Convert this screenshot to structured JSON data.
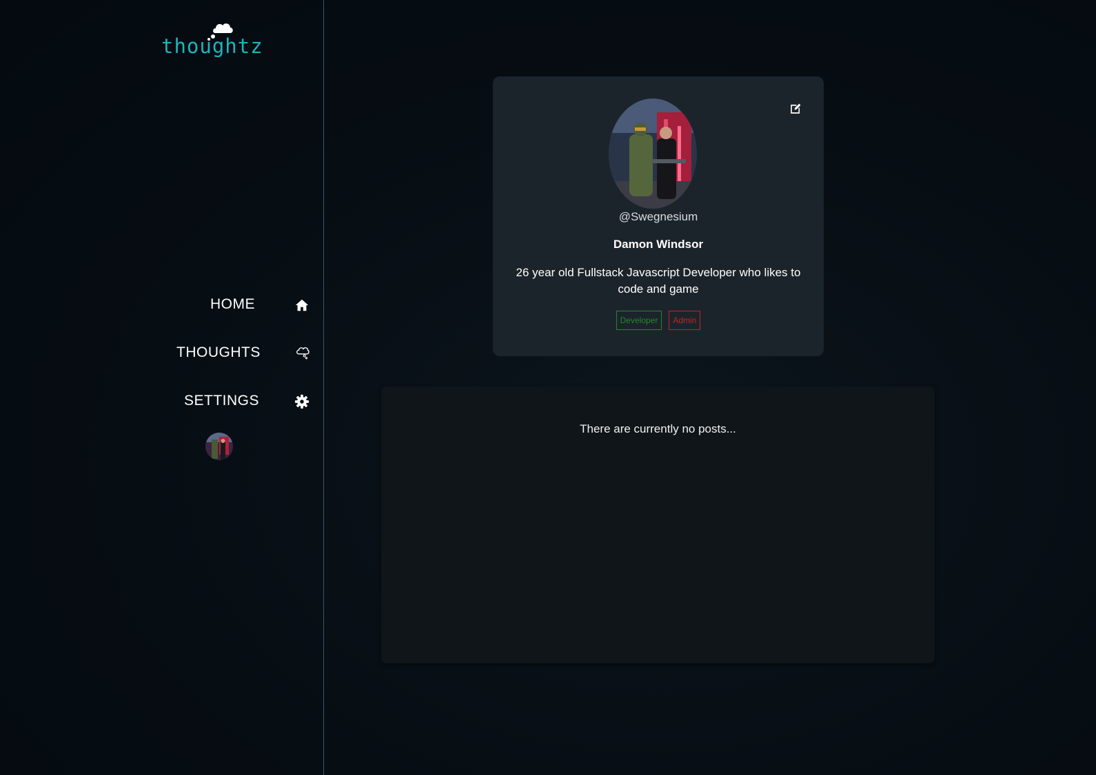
{
  "brand": {
    "logo_text": "thoughtz"
  },
  "nav": {
    "items": [
      {
        "label": "HOME",
        "icon": "home-icon"
      },
      {
        "label": "THOUGHTS",
        "icon": "thought-cloud-icon"
      },
      {
        "label": "SETTINGS",
        "icon": "gear-icon"
      }
    ]
  },
  "profile": {
    "handle": "@Swegnesium",
    "name": "Damon Windsor",
    "bio": "26 year old Fullstack Javascript Developer who likes to code and game",
    "badges": [
      {
        "label": "Developer",
        "color": "#1e8a2a"
      },
      {
        "label": "Admin",
        "color": "#c1232a"
      }
    ]
  },
  "posts": {
    "empty_message": "There are currently no posts..."
  },
  "theme": {
    "accent": "#1cb5bd",
    "card_bg": "#1c242b",
    "panel_bg": "#0f1519"
  }
}
